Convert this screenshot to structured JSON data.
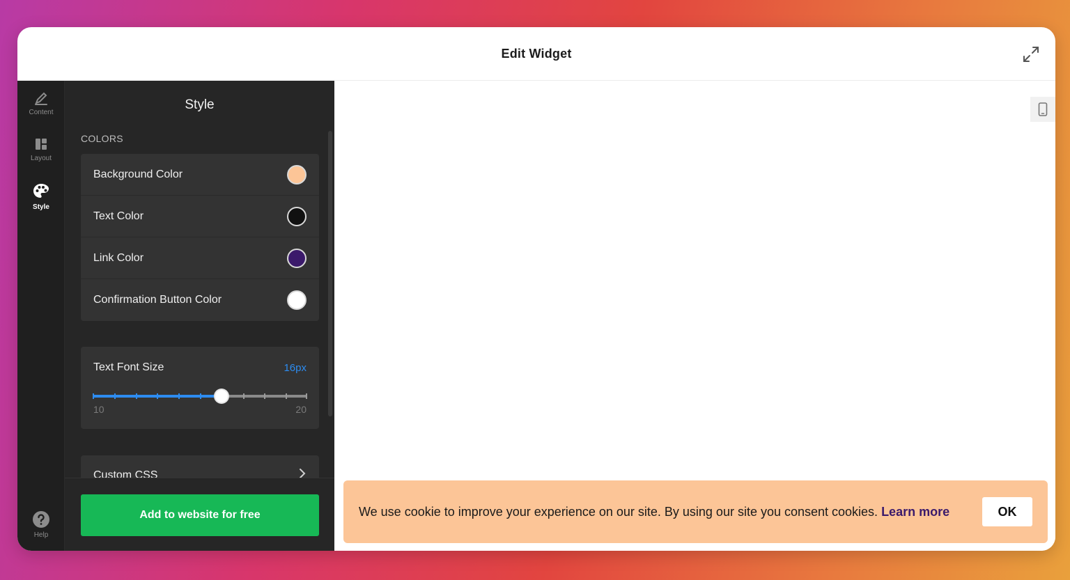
{
  "header": {
    "title": "Edit Widget",
    "expand_icon": "expand-icon"
  },
  "rail": {
    "items": [
      {
        "label": "Content",
        "icon": "pencil-icon"
      },
      {
        "label": "Layout",
        "icon": "layout-icon"
      },
      {
        "label": "Style",
        "icon": "palette-icon",
        "active": true
      }
    ],
    "help": {
      "label": "Help",
      "icon": "help-icon"
    }
  },
  "panel": {
    "title": "Style",
    "colors_section": "COLORS",
    "colors": [
      {
        "label": "Background Color",
        "value": "#fcc597"
      },
      {
        "label": "Text Color",
        "value": "#111111"
      },
      {
        "label": "Link Color",
        "value": "#3b1a6b"
      },
      {
        "label": "Confirmation Button Color",
        "value": "#ffffff"
      }
    ],
    "font_size": {
      "label": "Text Font Size",
      "value": "16px",
      "current": 16,
      "min": 10,
      "max": 20,
      "min_label": "10",
      "max_label": "20"
    },
    "custom_css": {
      "label": "Custom CSS"
    },
    "cta_label": "Add to website for free"
  },
  "preview": {
    "device_icon": "mobile-icon",
    "cookie": {
      "text": "We use cookie to improve your experience on our site. By using our site you consent cookies.",
      "link": "Learn more",
      "button": "OK"
    }
  },
  "accent": {
    "green": "#17b856",
    "blue": "#2d8cf0"
  }
}
